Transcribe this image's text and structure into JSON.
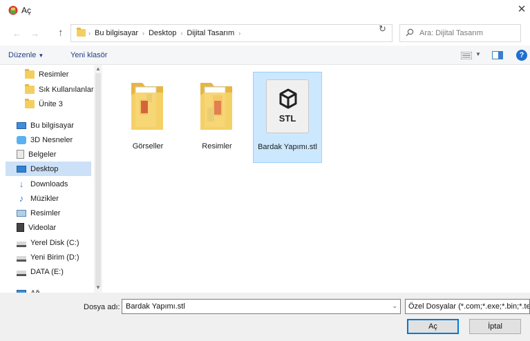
{
  "window": {
    "title": "Aç",
    "close_glyph": "✕"
  },
  "nav": {
    "back_icon": "←",
    "forward_icon": "→",
    "up_icon": "↑",
    "breadcrumbs": [
      "Bu bilgisayar",
      "Desktop",
      "Dijital Tasarım"
    ],
    "sep": "›",
    "dropdown_glyph": "⌄",
    "refresh_glyph": "↻",
    "search_placeholder": "Ara: Dijital Tasarım"
  },
  "toolbar": {
    "organize_label": "Düzenle",
    "new_folder_label": "Yeni klasör",
    "help_glyph": "?"
  },
  "sidebar": {
    "items": [
      {
        "label": "Resimler",
        "icon": "folder-icon"
      },
      {
        "label": "Sık Kullanılanlar",
        "icon": "folder-icon"
      },
      {
        "label": "Ünite 3",
        "icon": "folder-icon"
      },
      {
        "label": "Bu bilgisayar",
        "icon": "computer-icon"
      },
      {
        "label": "3D Nesneler",
        "icon": "3d-objects-icon"
      },
      {
        "label": "Belgeler",
        "icon": "documents-icon"
      },
      {
        "label": "Desktop",
        "icon": "desktop-icon",
        "selected": true
      },
      {
        "label": "Downloads",
        "icon": "downloads-icon"
      },
      {
        "label": "Müzikler",
        "icon": "music-icon"
      },
      {
        "label": "Resimler",
        "icon": "pictures-icon"
      },
      {
        "label": "Videolar",
        "icon": "videos-icon"
      },
      {
        "label": "Yerel Disk (C:)",
        "icon": "local-disk-icon"
      },
      {
        "label": "Yeni Birim (D:)",
        "icon": "drive-icon"
      },
      {
        "label": "DATA (E:)",
        "icon": "drive-icon"
      },
      {
        "label": "Ağ",
        "icon": "network-icon"
      }
    ]
  },
  "files": [
    {
      "name": "Görseller",
      "type": "folder"
    },
    {
      "name": "Resimler",
      "type": "folder"
    },
    {
      "name": "Bardak Yapımı.stl",
      "type": "stl",
      "badge": "STL",
      "selected": true
    }
  ],
  "bottom": {
    "filename_label": "Dosya adı:",
    "filename_value": "Bardak Yapımı.stl",
    "filter_value": "Özel Dosyalar (*.com;*.exe;*.bin;*.tex",
    "open_label": "Aç",
    "cancel_label": "İptal"
  }
}
